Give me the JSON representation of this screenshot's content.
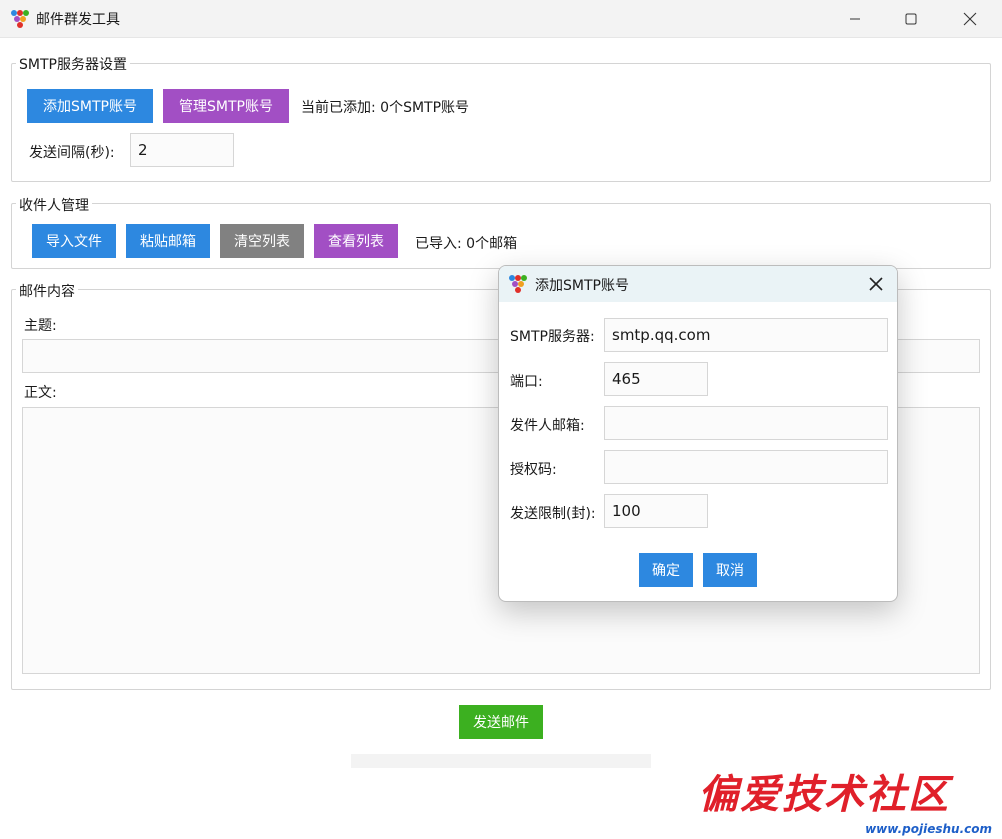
{
  "window": {
    "title": "邮件群发工具"
  },
  "smtp_group": {
    "title": "SMTP服务器设置",
    "add_button": "添加SMTP账号",
    "manage_button": "管理SMTP账号",
    "status": "当前已添加: 0个SMTP账号",
    "interval_label": "发送间隔(秒):",
    "interval_value": "2"
  },
  "recipient_group": {
    "title": "收件人管理",
    "import_button": "导入文件",
    "paste_button": "粘贴邮箱",
    "clear_button": "清空列表",
    "view_button": "查看列表",
    "status": "已导入: 0个邮箱"
  },
  "content_group": {
    "title": "邮件内容",
    "subject_label": "主题:",
    "subject_value": "",
    "body_label": "正文:",
    "body_value": ""
  },
  "send_button": "发送邮件",
  "progress": 0,
  "dialog": {
    "title": "添加SMTP账号",
    "server_label": "SMTP服务器:",
    "server_value": "smtp.qq.com",
    "port_label": "端口:",
    "port_value": "465",
    "sender_label": "发件人邮箱:",
    "sender_value": "",
    "auth_label": "授权码:",
    "auth_value": "",
    "limit_label": "发送限制(封):",
    "limit_value": "100",
    "ok_button": "确定",
    "cancel_button": "取消"
  },
  "watermark": {
    "text": "偏爱技术社区",
    "url": "www.pojieshu.com"
  },
  "colors": {
    "blue_button": "#2d88e0",
    "purple_button": "#a24fc4",
    "gray_button": "#818181",
    "green_button": "#3cb020",
    "dialog_titlebar": "#eaf3f6"
  },
  "icons": [
    "app-icon",
    "minimize-icon",
    "maximize-icon",
    "close-icon",
    "dialog-close-icon"
  ]
}
